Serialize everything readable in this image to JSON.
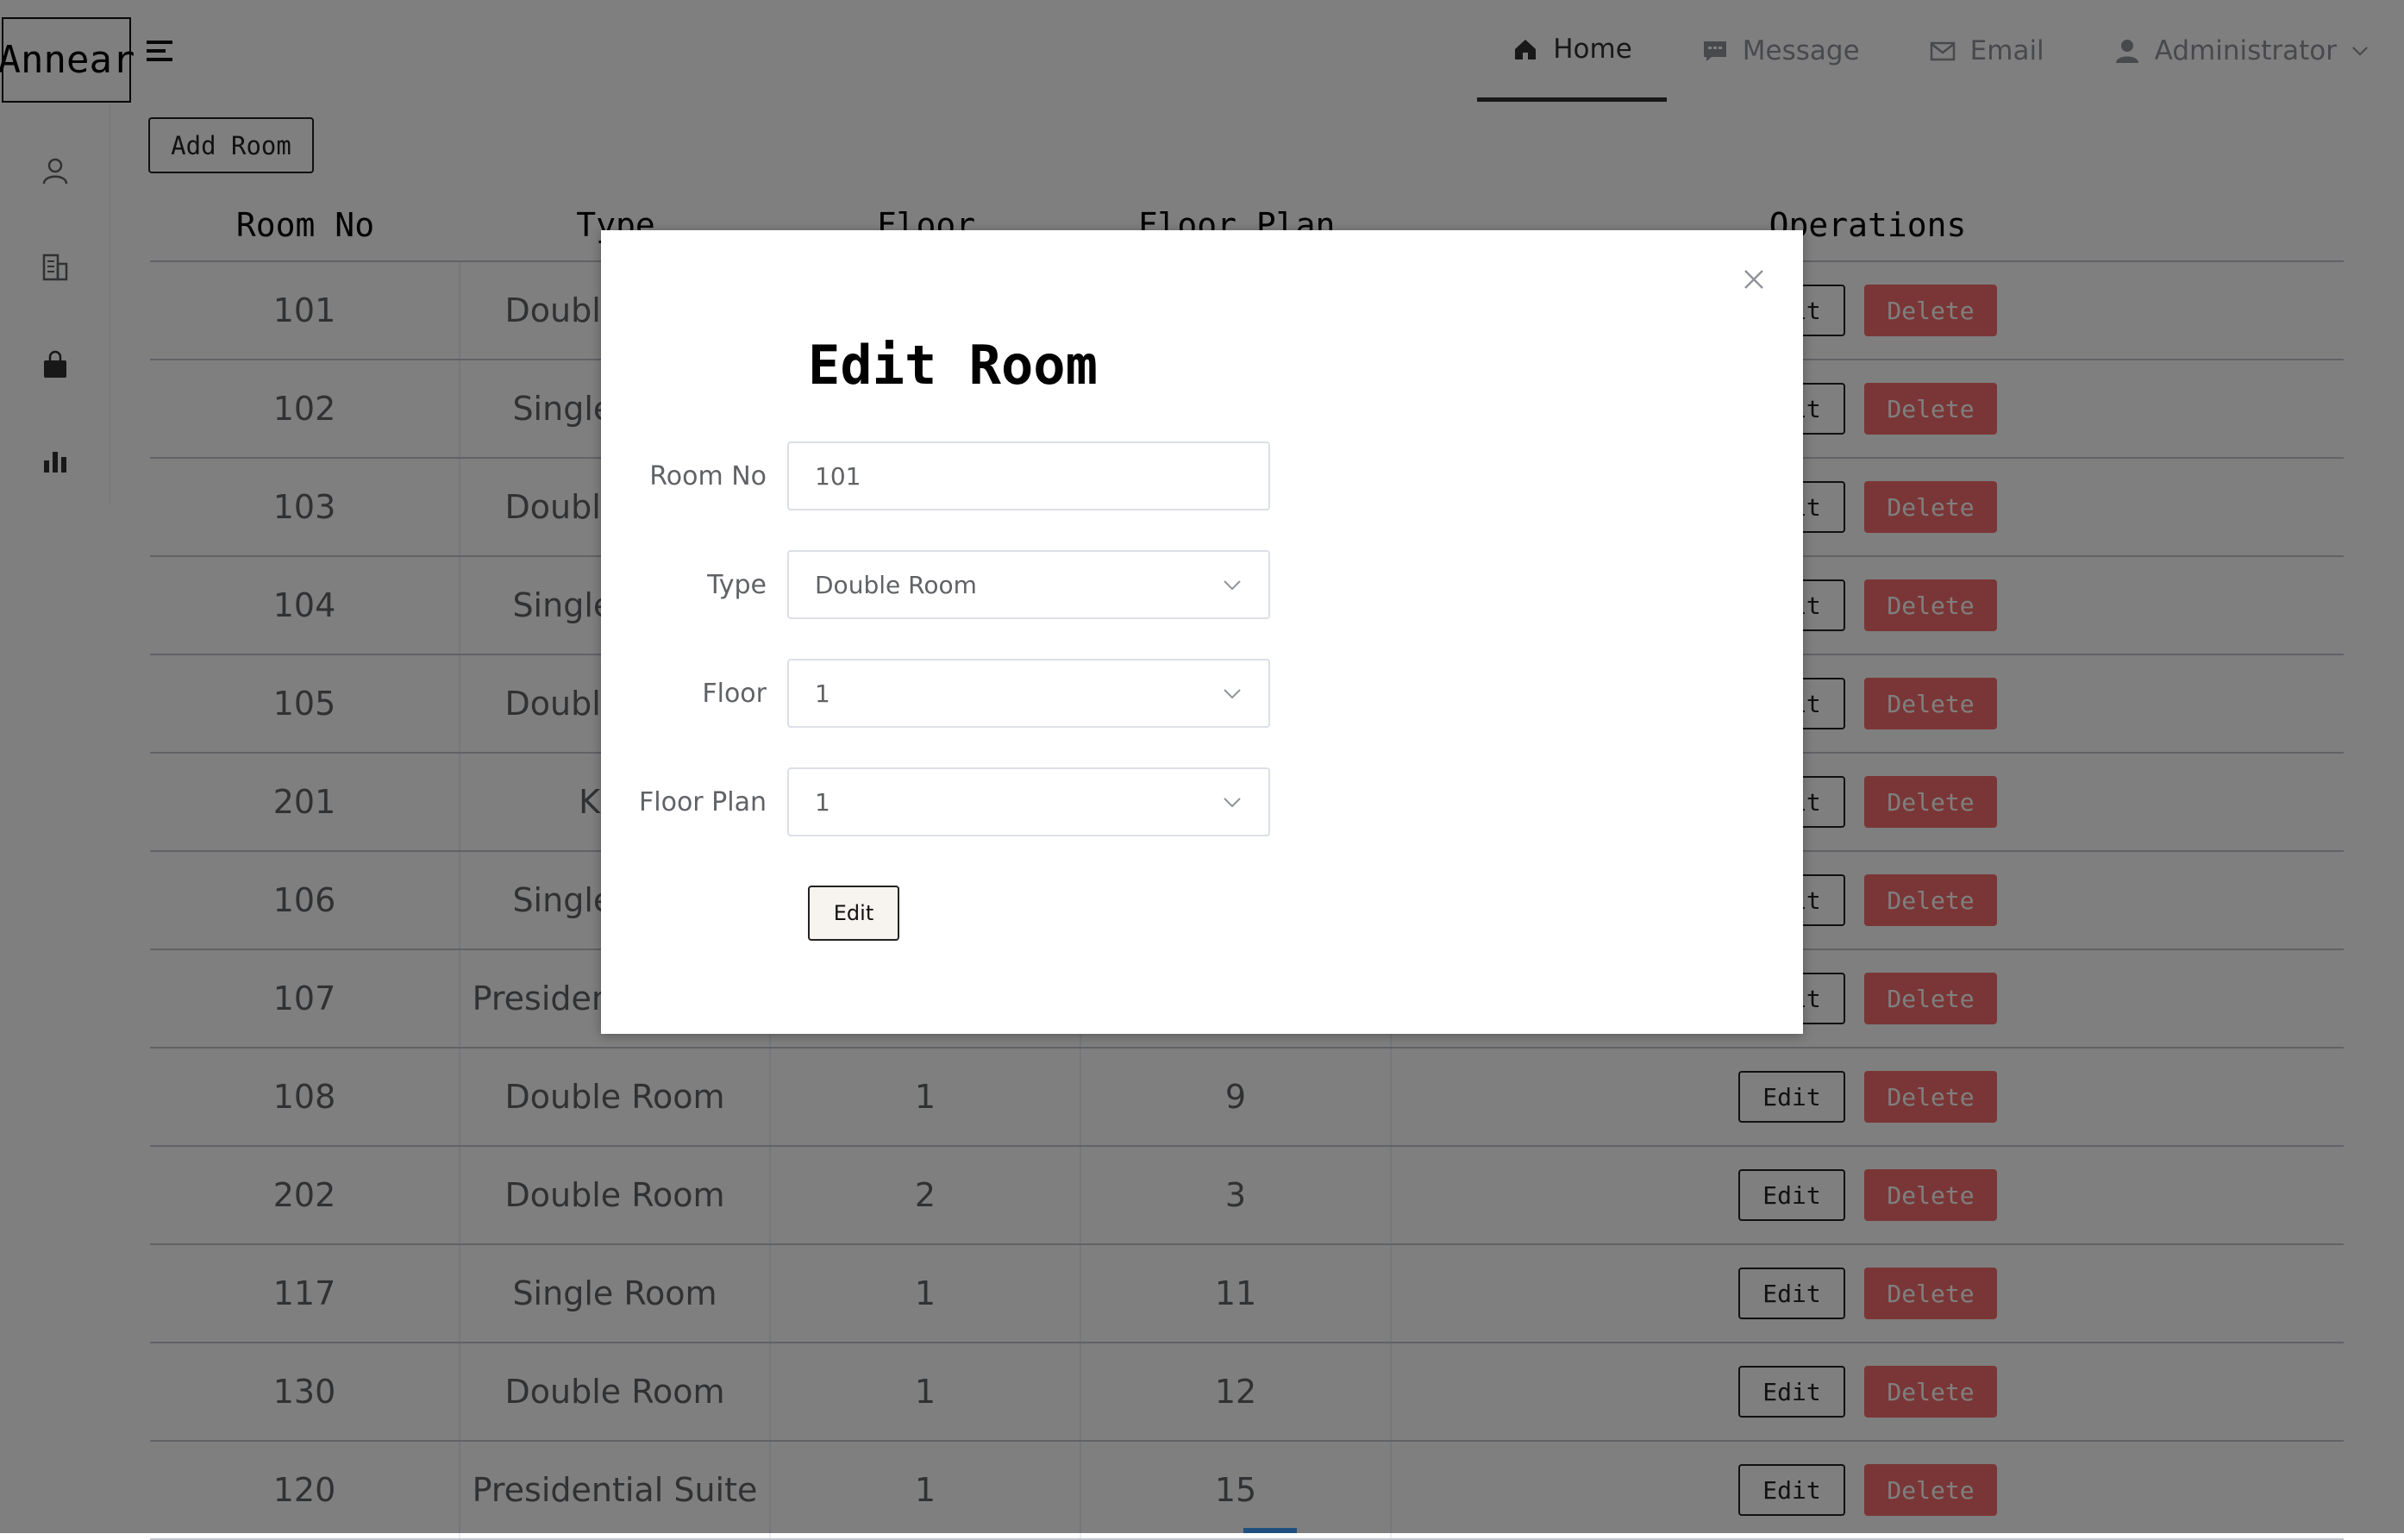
{
  "header": {
    "logo": "Annear",
    "nav": [
      {
        "label": "Home",
        "icon": "home-icon"
      },
      {
        "label": "Message",
        "icon": "message-icon"
      },
      {
        "label": "Email",
        "icon": "email-icon"
      },
      {
        "label": "Administrator",
        "icon": "user-icon"
      }
    ]
  },
  "sidebar": {
    "icons": [
      "user-icon",
      "building-icon",
      "bag-icon",
      "bar-chart-icon"
    ]
  },
  "toolbar": {
    "add_room_label": "Add Room"
  },
  "table": {
    "columns": [
      "Room No",
      "Type",
      "Floor",
      "Floor Plan",
      "Operations"
    ],
    "edit_label": "Edit",
    "delete_label": "Delete",
    "rows": [
      {
        "room": "101",
        "type": "Double Room",
        "floor": "",
        "plan": ""
      },
      {
        "room": "102",
        "type": "Single Room",
        "floor": "",
        "plan": ""
      },
      {
        "room": "103",
        "type": "Double Room",
        "floor": "",
        "plan": ""
      },
      {
        "room": "104",
        "type": "Single Room",
        "floor": "",
        "plan": ""
      },
      {
        "room": "105",
        "type": "Double Room",
        "floor": "",
        "plan": ""
      },
      {
        "room": "201",
        "type": "King",
        "floor": "",
        "plan": ""
      },
      {
        "room": "106",
        "type": "Single Room",
        "floor": "",
        "plan": ""
      },
      {
        "room": "107",
        "type": "Presidential Suite",
        "floor": "",
        "plan": ""
      },
      {
        "room": "108",
        "type": "Double Room",
        "floor": "1",
        "plan": "9"
      },
      {
        "room": "202",
        "type": "Double Room",
        "floor": "2",
        "plan": "3"
      },
      {
        "room": "117",
        "type": "Single Room",
        "floor": "1",
        "plan": "11"
      },
      {
        "room": "130",
        "type": "Double Room",
        "floor": "1",
        "plan": "12"
      },
      {
        "room": "120",
        "type": "Presidential Suite",
        "floor": "1",
        "plan": "15"
      }
    ]
  },
  "dialog": {
    "title": "Edit Room",
    "fields": [
      {
        "label": "Room No",
        "value": "101",
        "kind": "input"
      },
      {
        "label": "Type",
        "value": "Double Room",
        "kind": "select"
      },
      {
        "label": "Floor",
        "value": "1",
        "kind": "select"
      },
      {
        "label": "Floor Plan",
        "value": "1",
        "kind": "select"
      }
    ],
    "submit_label": "Edit"
  },
  "colors": {
    "delete": "#f56c6c",
    "active_nav": "#303133",
    "mask": "rgba(0,0,0,0.5)"
  }
}
